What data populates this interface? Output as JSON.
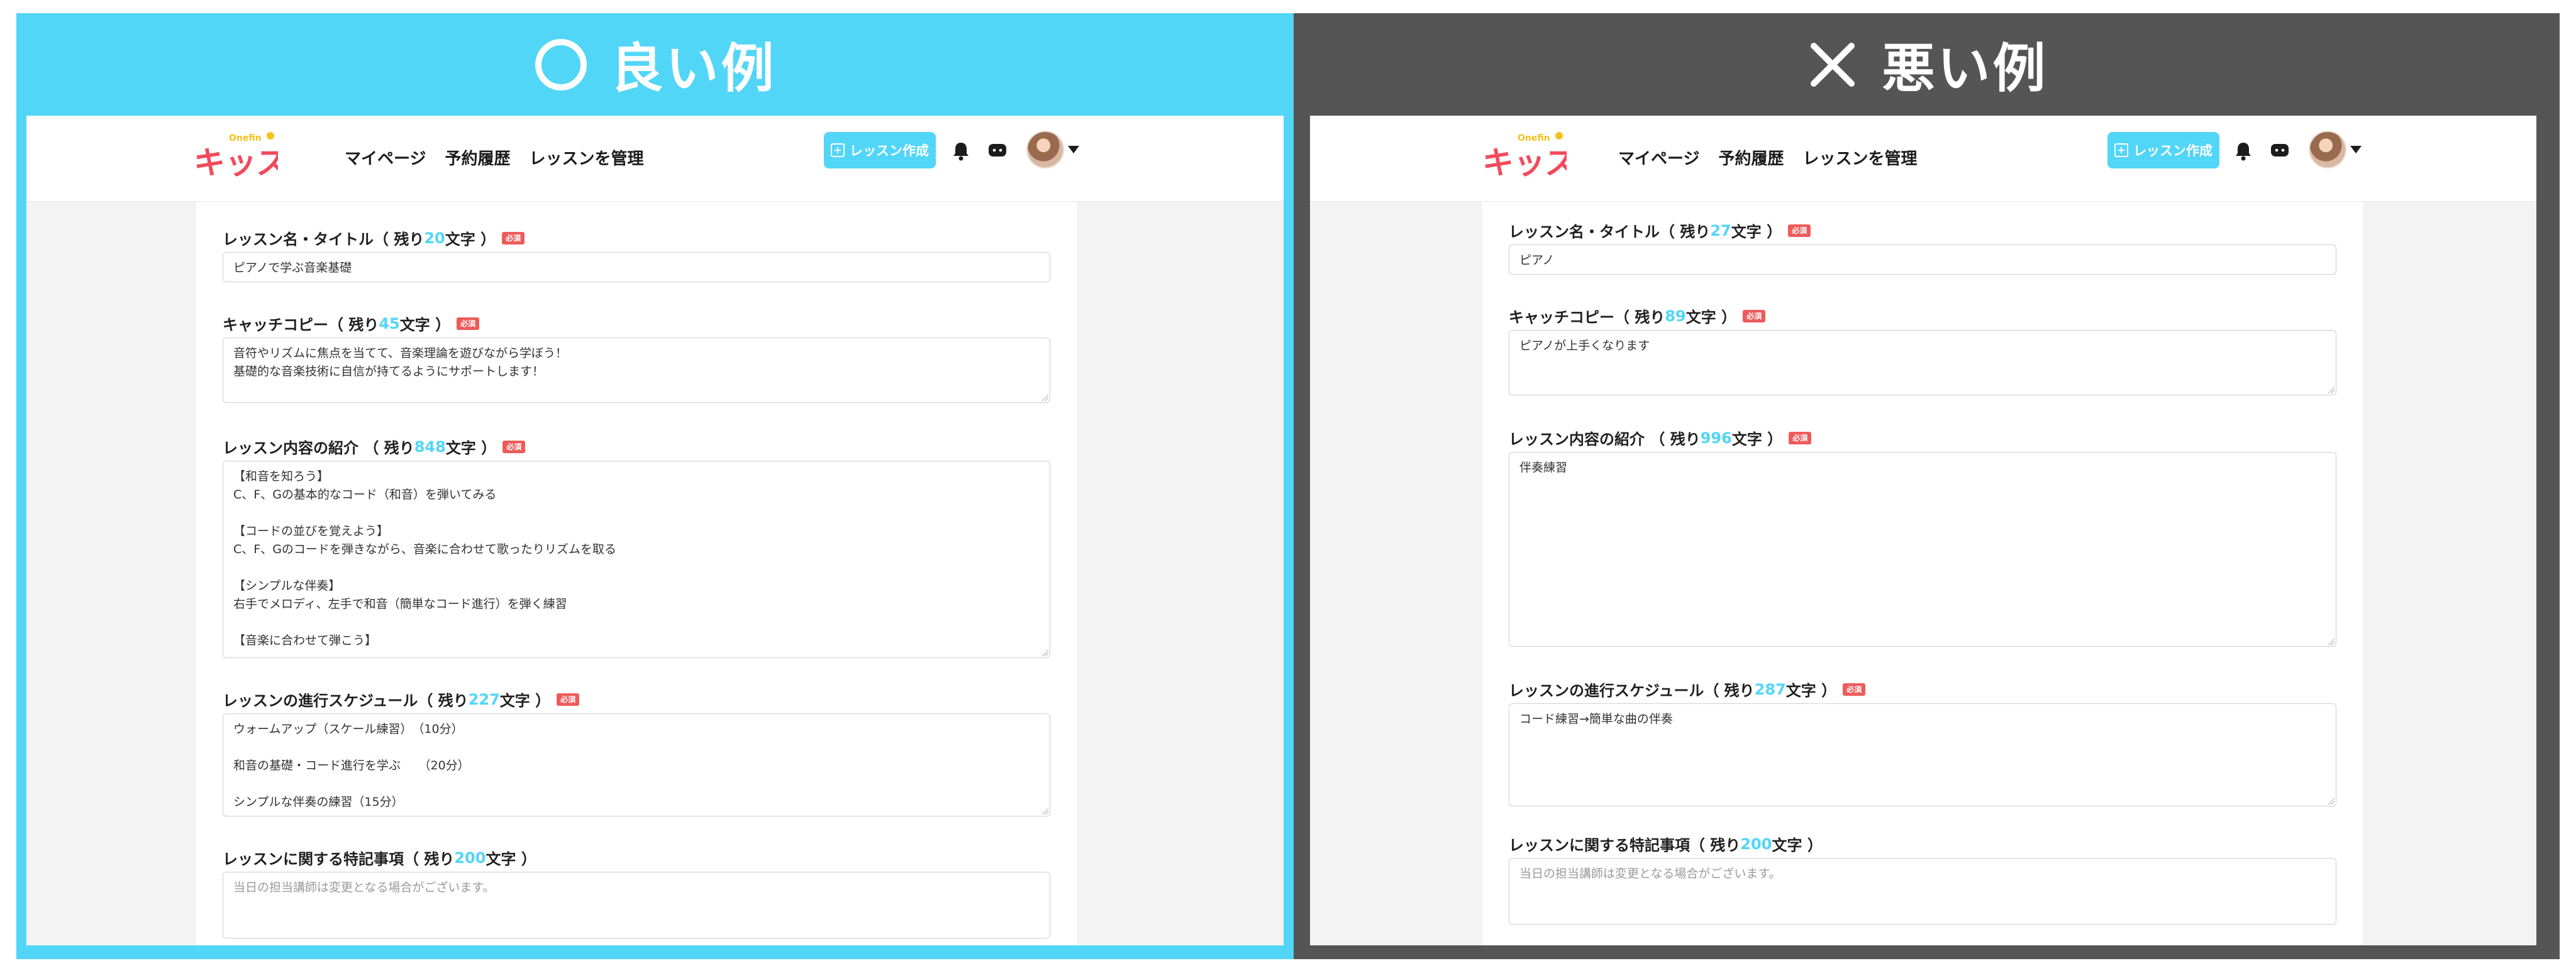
{
  "good": {
    "heading": "良い例",
    "app": {
      "logo_small": "Onefin",
      "logo_text": "キッズ",
      "nav": [
        "マイページ",
        "予約履歴",
        "レッスンを管理"
      ],
      "create_button": "レッスン作成"
    },
    "fields": [
      {
        "label": "レッスン名・タイトル（ 残り",
        "count": "20",
        "suffix": "文字 ）",
        "required": "必須",
        "value": "ピアノで学ぶ音楽基礎"
      },
      {
        "label": "キャッチコピー（ 残り",
        "count": "45",
        "suffix": "文字 ）",
        "required": "必須",
        "value": "音符やリズムに焦点を当てて、音楽理論を遊びながら学ぼう！\n基礎的な音楽技術に自信が持てるようにサポートします！"
      },
      {
        "label": "レッスン内容の紹介 （ 残り",
        "count": "848",
        "suffix": "文字 ）",
        "required": "必須",
        "value": "【和音を知ろう】\nC、F、Gの基本的なコード（和音）を弾いてみる\n\n【コードの並びを覚えよう】\nC、F、Gのコードを弾きながら、音楽に合わせて歌ったりリズムを取る\n\n【シンプルな伴奏】\n右手でメロディ、左手で和音（簡単なコード進行）を弾く練習\n\n【音楽に合わせて弾こう】"
      },
      {
        "label": "レッスンの進行スケジュール（ 残り",
        "count": "227",
        "suffix": "文字 ）",
        "required": "必須",
        "value": "ウォームアップ（スケール練習）　（10分）\n\n和音の基礎・コード進行を学ぶ　　（20分）\n\nシンプルな伴奏の練習（15分）"
      },
      {
        "label": "レッスンに関する特記事項（ 残り",
        "count": "200",
        "suffix": "文字 ）",
        "required": "",
        "placeholder": "当日の担当講師は変更となる場合がございます。"
      }
    ]
  },
  "bad": {
    "heading": "悪い例",
    "app": {
      "logo_small": "Onefin",
      "logo_text": "キッズ",
      "nav": [
        "マイページ",
        "予約履歴",
        "レッスンを管理"
      ],
      "create_button": "レッスン作成"
    },
    "fields": [
      {
        "label": "レッスン名・タイトル（ 残り",
        "count": "27",
        "suffix": "文字 ）",
        "required": "必須",
        "value": "ピアノ"
      },
      {
        "label": "キャッチコピー（ 残り",
        "count": "89",
        "suffix": "文字 ）",
        "required": "必須",
        "value": "ピアノが上手くなります"
      },
      {
        "label": "レッスン内容の紹介 （ 残り",
        "count": "996",
        "suffix": "文字 ）",
        "required": "必須",
        "value": "伴奏練習"
      },
      {
        "label": "レッスンの進行スケジュール（ 残り",
        "count": "287",
        "suffix": "文字 ）",
        "required": "必須",
        "value": "コード練習→簡単な曲の伴奏"
      },
      {
        "label": "レッスンに関する特記事項（ 残り",
        "count": "200",
        "suffix": "文字 ）",
        "required": "",
        "placeholder": "当日の担当講師は変更となる場合がございます。"
      }
    ]
  },
  "colors": {
    "accent": "#52d6f7",
    "bad_panel": "#555555",
    "required_badge": "#ee5a5a",
    "logo_red": "#f24a5b",
    "logo_yellow": "#f5c21b"
  },
  "icons": [
    "circle-good-icon",
    "cross-bad-icon",
    "plus-icon",
    "bell-icon",
    "chat-icon",
    "avatar",
    "caret-down-icon"
  ]
}
